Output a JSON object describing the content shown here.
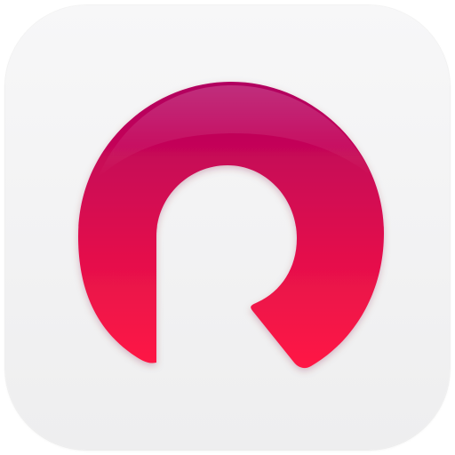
{
  "app_icon": {
    "name": "app-icon",
    "background_color": "#f2f2f3",
    "logo": {
      "icon": "circular-arrow-r-logo",
      "gradient_top": "#b1005f",
      "gradient_bottom": "#ff1744"
    }
  }
}
